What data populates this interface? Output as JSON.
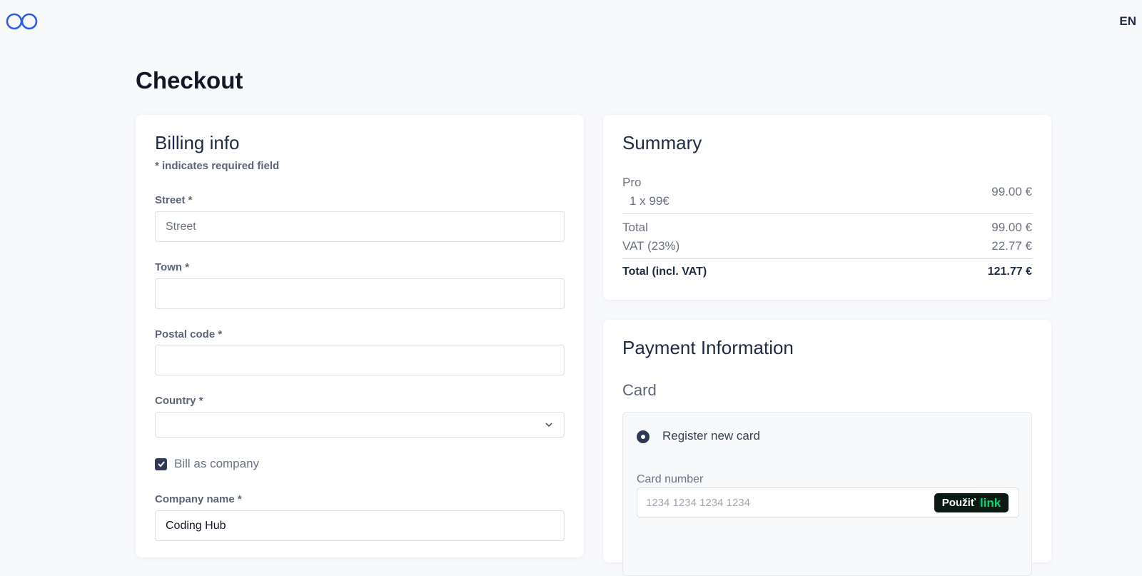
{
  "header": {
    "language": "EN"
  },
  "page": {
    "title": "Checkout"
  },
  "billing": {
    "title": "Billing info",
    "required_note": "* indicates required field",
    "street": {
      "label": "Street *",
      "placeholder": "Street",
      "value": ""
    },
    "town": {
      "label": "Town *",
      "value": ""
    },
    "postal_code": {
      "label": "Postal code *",
      "value": ""
    },
    "country": {
      "label": "Country *",
      "value": ""
    },
    "bill_as_company": {
      "label": "Bill as company",
      "checked": true
    },
    "company_name": {
      "label": "Company name *",
      "value": "Coding Hub"
    }
  },
  "summary": {
    "title": "Summary",
    "item": {
      "name": "Pro",
      "qty": "1 x 99€",
      "price": "99.00 €"
    },
    "total": {
      "label": "Total",
      "value": "99.00 €"
    },
    "vat": {
      "label": "VAT (23%)",
      "value": "22.77 €"
    },
    "total_incl": {
      "label": "Total (incl. VAT)",
      "value": "121.77 €"
    }
  },
  "payment": {
    "title": "Payment Information",
    "subtitle": "Card",
    "option_label": "Register new card",
    "card_number": {
      "label": "Card number",
      "placeholder": "1234 1234 1234 1234"
    },
    "link_button": {
      "text": "Použiť",
      "brand": "link"
    }
  },
  "colors": {
    "accent": "#2f3b55",
    "logo": "#2b5ee8",
    "link_green": "#00d66f"
  }
}
